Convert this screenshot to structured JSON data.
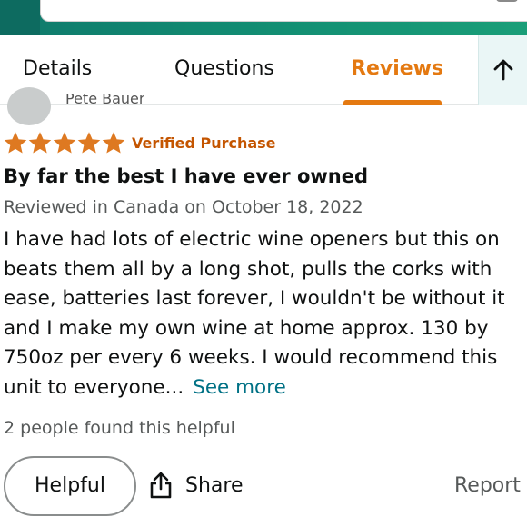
{
  "tabs": {
    "details": "Details",
    "questions": "Questions",
    "reviews": "Reviews"
  },
  "review": {
    "reviewer_name": "Pete Bauer",
    "rating": 5,
    "rating_max": 5,
    "verified_label": "Verified Purchase",
    "title": "By far the best I have ever owned",
    "meta": "Reviewed in Canada on October 18, 2022",
    "body": "I have had lots of electric wine openers but this on beats them all by a long shot, pulls the corks with ease, batteries last forever, I wouldn't be without it and I make my own wine at home approx. 130 by 750oz per every 6 weeks. I would recommend this unit to everyone...",
    "see_more": "See more",
    "helpful_count": "2 people found this helpful"
  },
  "actions": {
    "helpful": "Helpful",
    "share": "Share",
    "report": "Report"
  },
  "icons": {
    "scroll_top": "arrow-up-icon",
    "share": "share-icon",
    "star": "star-icon"
  },
  "colors": {
    "accent": "#e47911",
    "star": "#de7921",
    "link": "#007185",
    "verified": "#c45500",
    "header": "#138f73"
  }
}
